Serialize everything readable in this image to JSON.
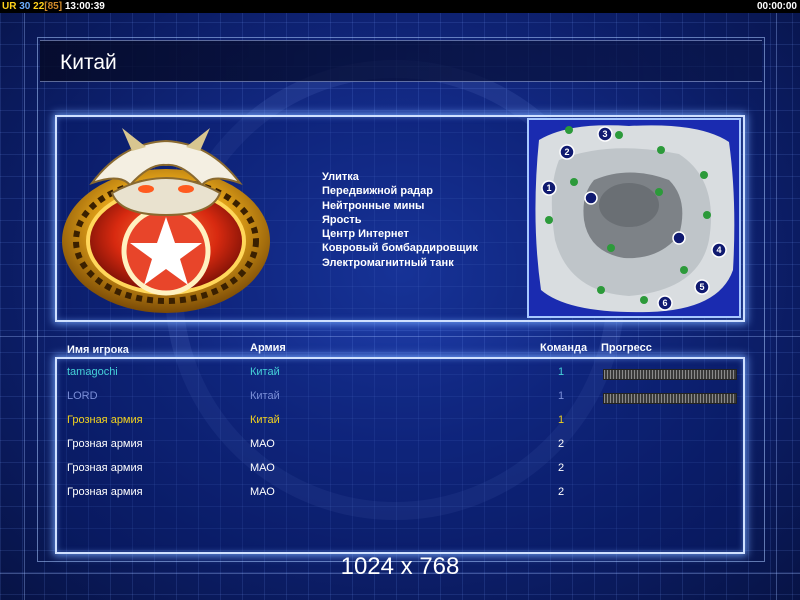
{
  "status_bar": {
    "left_ur": "UR",
    "left_a": "30",
    "left_b": "22",
    "left_c": "[85]",
    "left_time": "13:00:39",
    "right_time": "00:00:00"
  },
  "header": {
    "title": "Китай"
  },
  "faction": {
    "emblem_icon": "dragon-star-emblem-icon",
    "features": [
      "Улитка",
      "Передвижной радар",
      "Нейтронные мины",
      "Ярость",
      "Центр Интернет",
      "Ковровый бомбардировщик",
      "Электромагнитный танк"
    ]
  },
  "minimap": {
    "start_positions": [
      "1",
      "2",
      "3",
      "4",
      "5",
      "6"
    ]
  },
  "columns": {
    "player_name": "Имя игрока",
    "army": "Армия",
    "team": "Команда",
    "progress": "Прогресс"
  },
  "players": [
    {
      "name": "tamagochi",
      "army": "Китай",
      "team": "1",
      "color": "#45d0d8",
      "progress": 1.0
    },
    {
      "name": "LORD",
      "army": "Китай",
      "team": "1",
      "color": "#7b8fd8",
      "progress": 1.0
    },
    {
      "name": "Грозная армия",
      "army": "Китай",
      "team": "1",
      "color": "#f2d21e"
    },
    {
      "name": "Грозная армия",
      "army": "МАО",
      "team": "2",
      "color": "#ffffff"
    },
    {
      "name": "Грозная армия",
      "army": "МАО",
      "team": "2",
      "color": "#ffffff"
    },
    {
      "name": "Грозная армия",
      "army": "МАО",
      "team": "2",
      "color": "#ffffff"
    }
  ],
  "resolution_label": "1024 x 768"
}
